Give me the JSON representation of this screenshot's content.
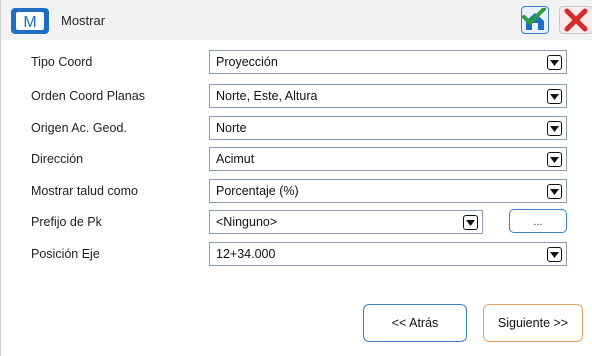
{
  "header": {
    "title": "Mostrar",
    "logo_letter": "M",
    "logo_icon": "app-logo-icon",
    "ok_icon": "home-check-icon",
    "close_icon": "close-icon",
    "colors": {
      "logo": "#1e6fc1",
      "check": "#2e9e3e",
      "close": "#d62b2b"
    }
  },
  "form": {
    "rows": [
      {
        "label": "Tipo Coord",
        "value": "Proyección"
      },
      {
        "label": "Orden Coord Planas",
        "value": "Norte, Este, Altura"
      },
      {
        "label": "Origen Ac. Geod.",
        "value": "Norte"
      },
      {
        "label": "Dirección",
        "value": "Acimut"
      },
      {
        "label": "Mostrar talud como",
        "value": "Porcentaje (%)"
      },
      {
        "label": "Prefijo de Pk",
        "value": "<Ninguno>",
        "button_label": "..."
      },
      {
        "label": "Posición Eje",
        "value": "12+34.000"
      }
    ]
  },
  "nav": {
    "back_label": "<< Atrás",
    "next_label": "Siguiente >>"
  }
}
